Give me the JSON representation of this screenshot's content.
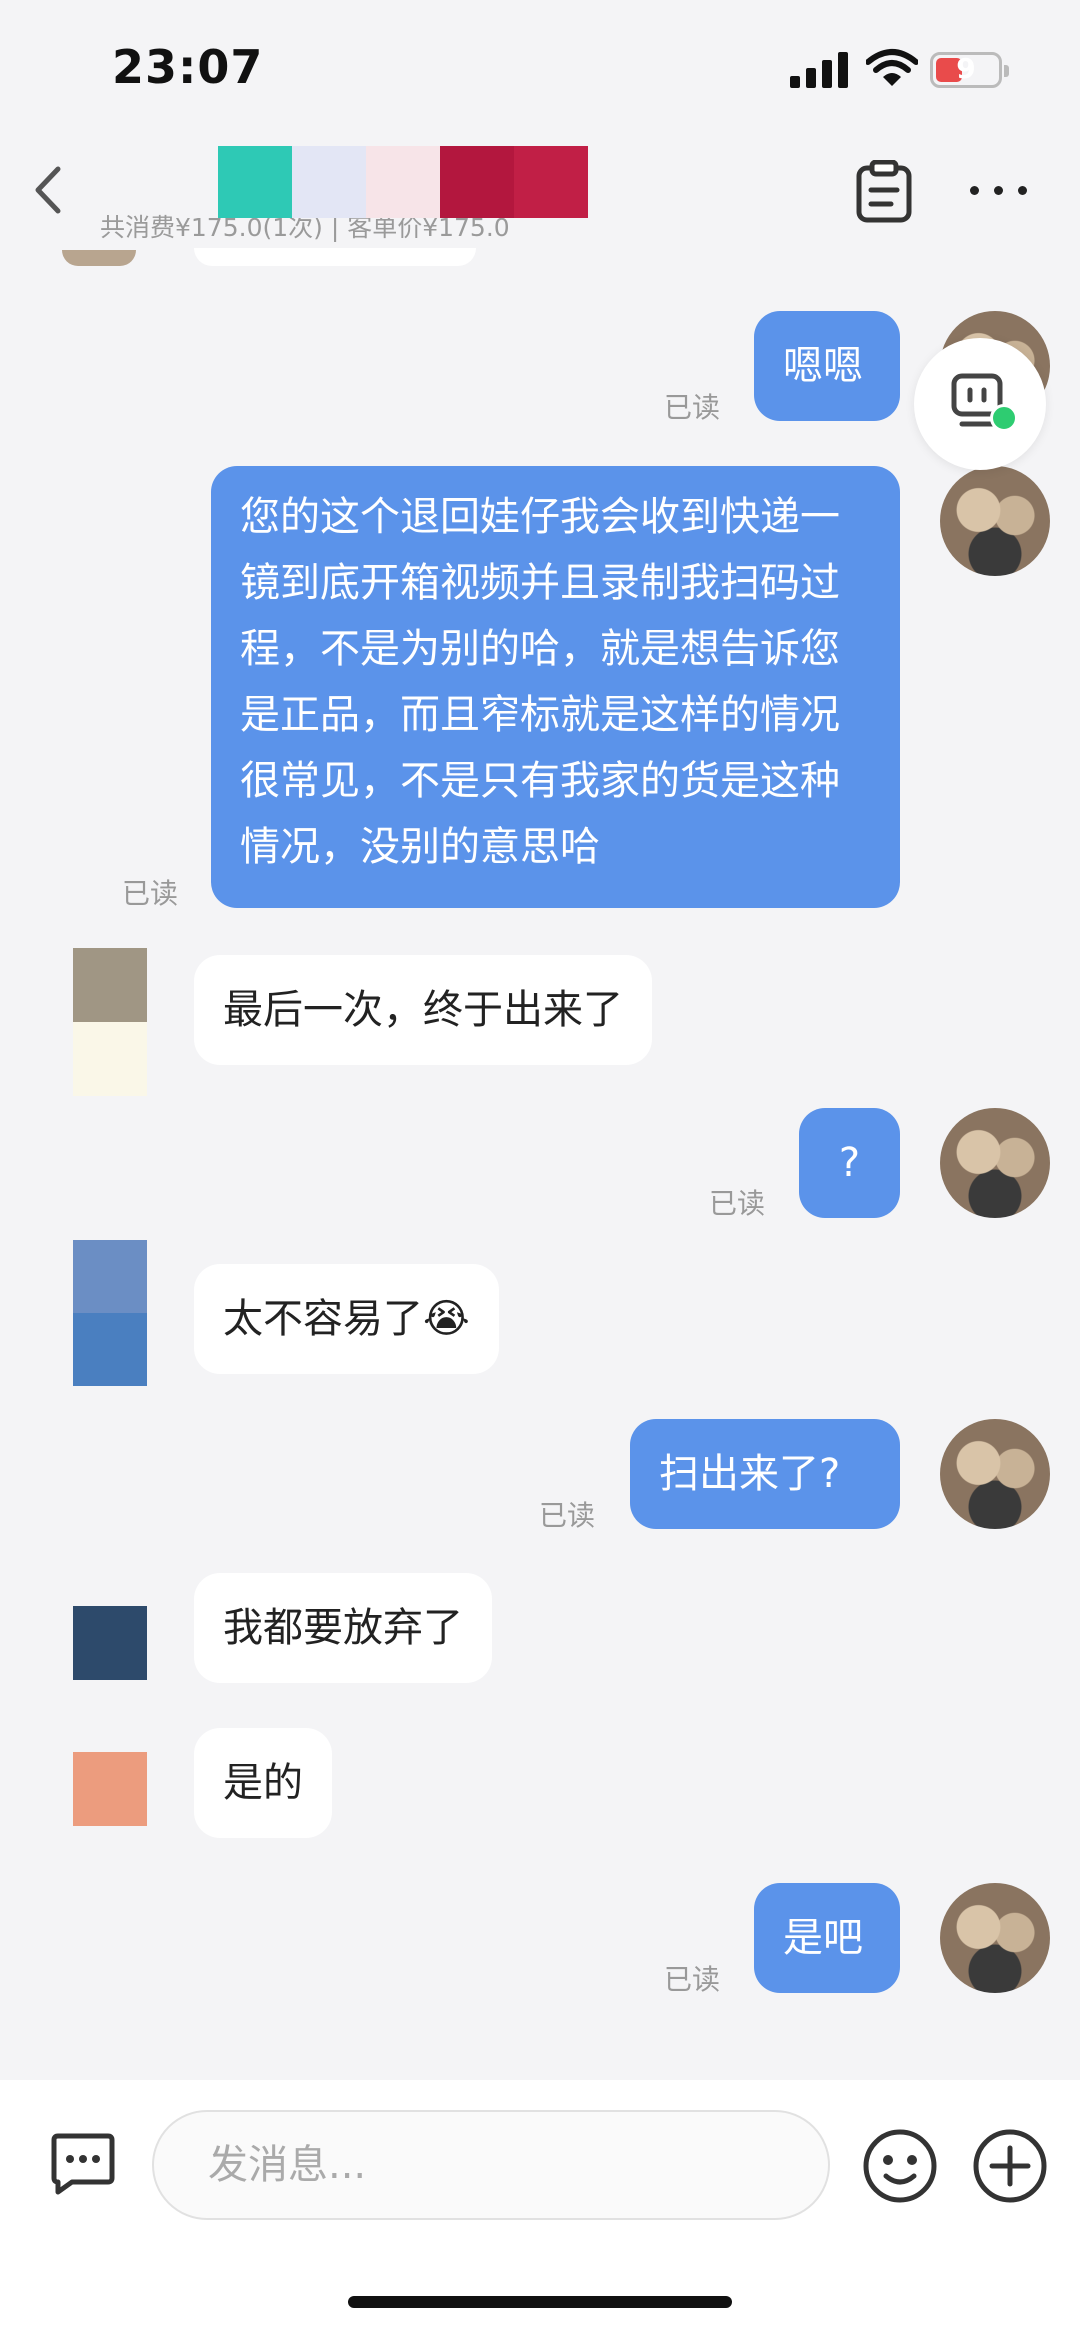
{
  "status_bar": {
    "time": "23:07",
    "battery": "9"
  },
  "header": {
    "subtitle": "共消费¥175.0(1次) | 客单价¥175.0",
    "name_colors": [
      "#2ec9b5",
      "#e3e6f5",
      "#f7e4e8",
      "#b3173e",
      "#c11f46"
    ]
  },
  "messages": [
    {
      "side": "me",
      "text": "嗯嗯",
      "status": "已读"
    },
    {
      "side": "me",
      "text": "您的这个退回娃仔我会收到快递一镜到底开箱视频并且录制我扫码过程，不是为别的哈，就是想告诉您是正品，而且窄标就是这样的情况很常见，不是只有我家的货是这种情况，没别的意思哈",
      "status": "已读"
    },
    {
      "side": "them",
      "text": "最后一次，终于出来了"
    },
    {
      "side": "me",
      "text": "?",
      "status": "已读"
    },
    {
      "side": "them",
      "text": "太不容易了😭"
    },
    {
      "side": "me",
      "text": "扫出来了?",
      "status": "已读"
    },
    {
      "side": "them",
      "text": "我都要放弃了"
    },
    {
      "side": "them",
      "text": "是的"
    },
    {
      "side": "me",
      "text": "是吧",
      "status": "已读"
    }
  ],
  "avatar_colors": {
    "a1": [
      "#a09684",
      "#faf7e8"
    ],
    "a2": [
      "#6b8ec4",
      "#4a7fc0"
    ],
    "a3": [
      "#2d4a6b"
    ],
    "a4": [
      "#ec9c7e"
    ]
  },
  "input": {
    "placeholder": "发消息..."
  },
  "icons": [
    "back-icon",
    "clipboard-icon",
    "more-icon",
    "robot-icon",
    "chat-icon",
    "emoji-icon",
    "plus-icon"
  ]
}
